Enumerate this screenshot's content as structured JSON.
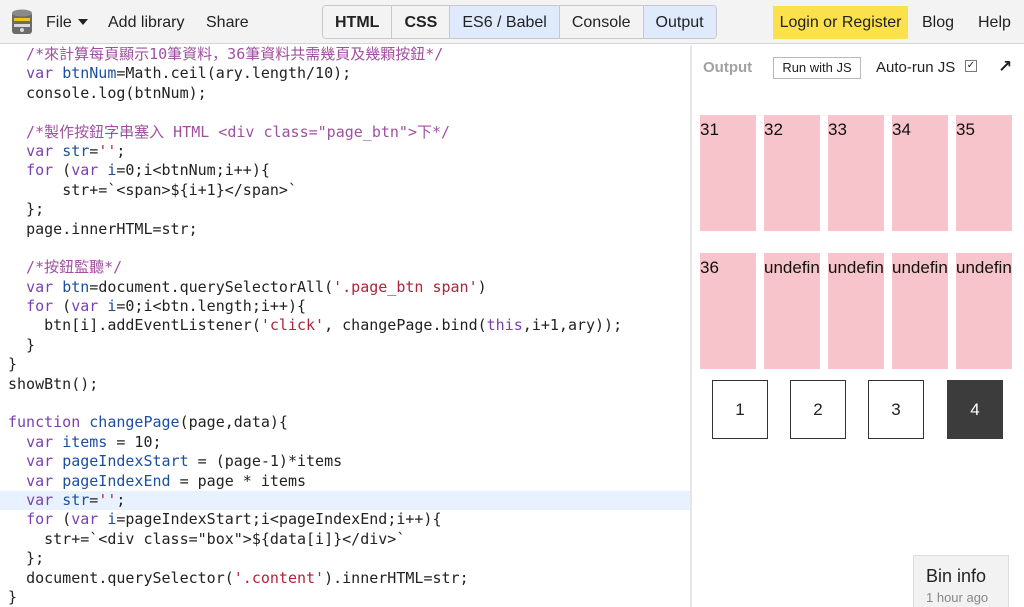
{
  "topbar": {
    "file": "File",
    "add_library": "Add library",
    "share": "Share",
    "toggles": [
      "HTML",
      "CSS",
      "ES6 / Babel",
      "Console",
      "Output"
    ],
    "login": "Login or Register",
    "blog": "Blog",
    "help": "Help"
  },
  "editor": {
    "lines": [
      "  /*來計算每頁顯示10筆資料，36筆資料共需幾頁及幾顆按鈕*/",
      "  var btnNum=Math.ceil(ary.length/10);",
      "  console.log(btnNum);",
      "",
      "  /*製作按鈕字串塞入 HTML <div class=\"page_btn\">下*/",
      "  var str='';",
      "  for (var i=0;i<btnNum;i++){",
      "      str+=`<span>${i+1}</span>`",
      "  };",
      "  page.innerHTML=str;",
      "",
      "  /*按鈕監聽*/",
      "  var btn=document.querySelectorAll('.page_btn span')",
      "  for (var i=0;i<btn.length;i++){",
      "    btn[i].addEventListener('click', changePage.bind(this,i+1,ary));",
      "  }",
      "}",
      "showBtn();",
      "",
      "function changePage(page,data){",
      "  var items = 10;",
      "  var pageIndexStart = (page-1)*items",
      "  var pageIndexEnd = page * items",
      "  var str='';",
      "  for (var i=pageIndexStart;i<pageIndexEnd;i++){",
      "    str+=`<div class=\"box\">${data[i]}</div>`",
      "  };",
      "  document.querySelector('.content').innerHTML=str;",
      "}"
    ],
    "active_line": 23
  },
  "output": {
    "label": "Output",
    "run_button": "Run with JS",
    "autorun_label": "Auto-run JS",
    "autorun_checked": "✓",
    "expand_icon": "↗",
    "boxes": [
      "31",
      "32",
      "33",
      "34",
      "35",
      "36",
      "undefined",
      "undefined",
      "undefined",
      "undefined"
    ],
    "page_buttons": [
      "1",
      "2",
      "3",
      "4"
    ],
    "current_page": 4
  },
  "bin_info": {
    "title": "Bin info",
    "time": "1 hour ago"
  }
}
